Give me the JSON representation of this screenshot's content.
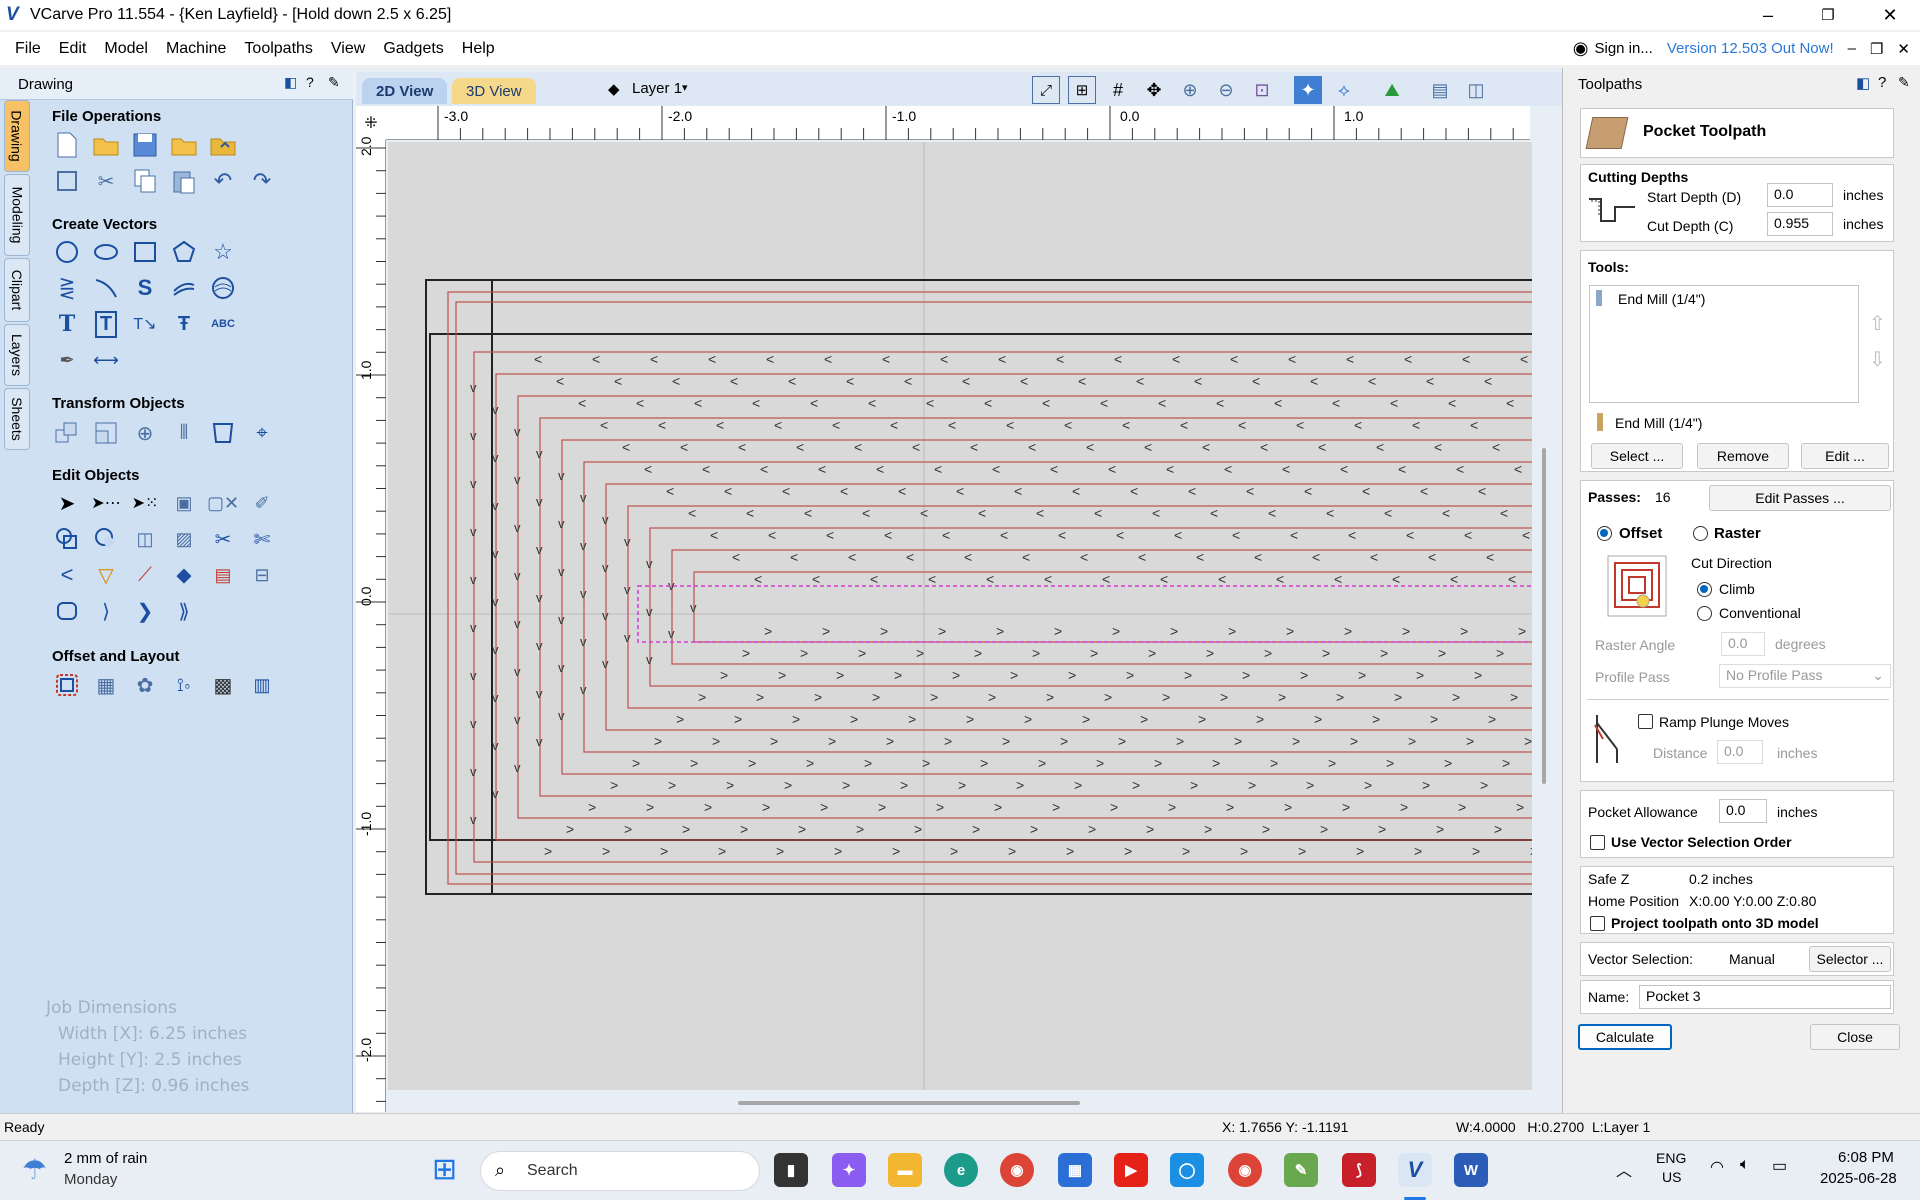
{
  "window": {
    "title": "VCarve Pro 11.554 - {Ken Layfield} - [Hold down 2.5 x 6.25]",
    "minimize": "–",
    "maximize": "❐",
    "close": "✕"
  },
  "menu": {
    "items": [
      "File",
      "Edit",
      "Model",
      "Machine",
      "Toolpaths",
      "View",
      "Gadgets",
      "Help"
    ],
    "sign_in": "Sign in...",
    "version_notice": "Version 12.503 Out Now!"
  },
  "left_panel": {
    "header": "Drawing",
    "vertical_tabs": [
      "Drawing",
      "Modeling",
      "Clipart",
      "Layers",
      "Sheets"
    ],
    "sections": {
      "file_operations": "File Operations",
      "create_vectors": "Create Vectors",
      "transform_objects": "Transform Objects",
      "edit_objects": "Edit Objects",
      "offset_layout": "Offset and Layout"
    },
    "job_dimensions": {
      "title": "Job Dimensions",
      "width": "Width  [X]: 6.25 inches",
      "height": "Height [Y]: 2.5 inches",
      "depth": "Depth  [Z]: 0.96 inches"
    }
  },
  "canvas": {
    "tab_2d": "2D View",
    "tab_3d": "3D View",
    "layer": "Layer 1",
    "ruler_x": [
      "-3.0",
      "-2.0",
      "-1.0",
      "0.0",
      "1.0"
    ],
    "ruler_y": [
      "2.0",
      "1.0",
      "0.0",
      "-1.0",
      "-2.0"
    ]
  },
  "right_panel": {
    "header": "Toolpaths",
    "toolpath_title": "Pocket Toolpath",
    "cutting_depths": {
      "title": "Cutting Depths",
      "start_label": "Start Depth (D)",
      "start_value": "0.0",
      "cut_label": "Cut Depth (C)",
      "cut_value": "0.955",
      "unit": "inches"
    },
    "tools": {
      "title": "Tools:",
      "list_item": "End Mill (1/4\")",
      "selected": "End Mill (1/4\")",
      "select_btn": "Select ...",
      "remove_btn": "Remove",
      "edit_btn": "Edit ..."
    },
    "passes": {
      "label": "Passes:",
      "value": "16",
      "edit_btn": "Edit Passes ..."
    },
    "strategy": {
      "offset": "Offset",
      "raster": "Raster",
      "cut_direction": "Cut Direction",
      "climb": "Climb",
      "conventional": "Conventional"
    },
    "raster_angle": {
      "label": "Raster Angle",
      "value": "0.0",
      "unit": "degrees"
    },
    "profile_pass": {
      "label": "Profile Pass",
      "value": "No Profile Pass"
    },
    "ramp": {
      "label": "Ramp Plunge Moves",
      "distance_label": "Distance",
      "distance_value": "0.0",
      "unit": "inches"
    },
    "pocket_allowance": {
      "label": "Pocket Allowance",
      "value": "0.0",
      "unit": "inches"
    },
    "use_vector_order": "Use Vector Selection Order",
    "safe_z": {
      "label": "Safe Z",
      "value": "0.2 inches"
    },
    "home_position": {
      "label": "Home Position",
      "value": "X:0.00 Y:0.00 Z:0.80"
    },
    "project_toolpath": "Project toolpath onto 3D model",
    "vector_selection": {
      "label": "Vector Selection:",
      "value": "Manual",
      "btn": "Selector ..."
    },
    "name": {
      "label": "Name:",
      "value": "Pocket 3"
    },
    "calculate": "Calculate",
    "close": "Close"
  },
  "status": {
    "ready": "Ready",
    "coords": "X: 1.7656 Y: -1.1191",
    "dims": "W:4.0000   H:0.2700  L:Layer 1"
  },
  "taskbar": {
    "weather_line1": "2 mm of rain",
    "weather_line2": "Monday",
    "search_placeholder": "Search",
    "lang1": "ENG",
    "lang2": "US",
    "time": "6:08 PM",
    "date": "2025-06-28"
  },
  "colors": {
    "accent": "#0067c0",
    "toolpath": "#c0504d",
    "selection": "#d63ad6"
  }
}
